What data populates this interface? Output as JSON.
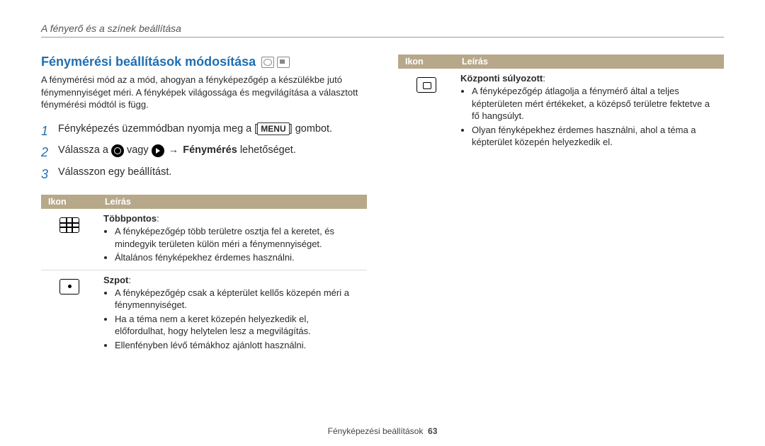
{
  "running_head": "A fényerő és a színek beállítása",
  "heading": "Fénymérési beállítások módosítása",
  "intro": "A fénymérési mód az a mód, ahogyan a fényképezőgép a készülékbe jutó fénymennyiséget méri. A fényképek világossága és megvilágítása a választott fénymérési módtól is függ.",
  "steps": {
    "s1_a": "Fényképezés üzemmódban nyomja meg a [",
    "s1_menu": "MENU",
    "s1_b": "] gombot.",
    "s2_a": "Válassza a ",
    "s2_or": " vagy ",
    "s2_arrow": " → ",
    "s2_bold": "Fénymérés",
    "s2_b": " lehetőséget.",
    "s3": "Válasszon egy beállítást."
  },
  "table": {
    "head_icon": "Ikon",
    "head_desc": "Leírás",
    "rows_left": [
      {
        "icon": "multi",
        "title": "Többpontos",
        "colon": ":",
        "bullets": [
          "A fényképezőgép több területre osztja fel a keretet, és mindegyik területen külön méri a fénymennyiséget.",
          "Általános fényképekhez érdemes használni."
        ]
      },
      {
        "icon": "spot",
        "title": "Szpot",
        "colon": ":",
        "bullets": [
          "A fényképezőgép csak a képterület kellős közepén méri a fénymennyiséget.",
          "Ha a téma nem a keret közepén helyezkedik el, előfordulhat, hogy helytelen lesz a megvilágítás.",
          "Ellenfényben lévő témákhoz ajánlott használni."
        ]
      }
    ],
    "rows_right": [
      {
        "icon": "center",
        "title": "Központi súlyozott",
        "colon": ":",
        "bullets": [
          "A fényképezőgép átlagolja a fénymérő által a teljes képterületen mért értékeket, a középső területre fektetve a fő hangsúlyt.",
          "Olyan fényképekhez érdemes használni, ahol a téma a képterület közepén helyezkedik el."
        ]
      }
    ]
  },
  "footer_label": "Fényképezési beállítások",
  "footer_page": "63"
}
